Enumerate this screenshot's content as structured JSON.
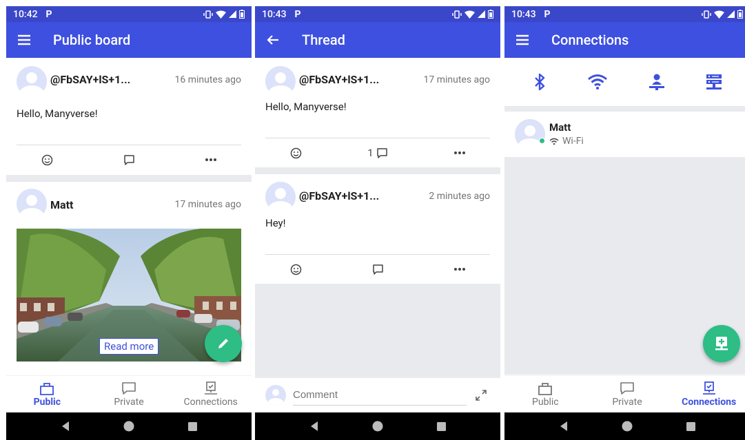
{
  "screens": [
    {
      "status_time": "10:42",
      "status_app_icon": "P",
      "title": "Public board",
      "posts": [
        {
          "author": "@FbSAY+lS+1...",
          "time": "16 minutes ago",
          "text": "Hello, Manyverse!"
        },
        {
          "author": "Matt",
          "time": "17 minutes ago",
          "read_more": "Read more"
        }
      ],
      "tabs": [
        {
          "label": "Public",
          "icon": "inbox-icon"
        },
        {
          "label": "Private",
          "icon": "chat-icon"
        },
        {
          "label": "Connections",
          "icon": "connections-icon"
        }
      ],
      "active_tab": "Public"
    },
    {
      "status_time": "10:43",
      "status_app_icon": "P",
      "title": "Thread",
      "posts": [
        {
          "author": "@FbSAY+lS+1...",
          "time": "17 minutes ago",
          "text": "Hello, Manyverse!",
          "reply_count": "1"
        },
        {
          "author": "@FbSAY+lS+1...",
          "time": "2 minutes ago",
          "text": "Hey!"
        }
      ],
      "comment_placeholder": "Comment"
    },
    {
      "status_time": "10:43",
      "status_app_icon": "P",
      "title": "Connections",
      "connection_icons": [
        "bluetooth-icon",
        "wifi-icon",
        "dht-icon",
        "server-icon"
      ],
      "peers": [
        {
          "name": "Matt",
          "network": "Wi-Fi"
        }
      ],
      "tabs": [
        {
          "label": "Public",
          "icon": "inbox-icon"
        },
        {
          "label": "Private",
          "icon": "chat-icon"
        },
        {
          "label": "Connections",
          "icon": "connections-icon"
        }
      ],
      "active_tab": "Connections"
    }
  ],
  "colors": {
    "status_bar": "#3b47c9",
    "app_bar": "#3e50e0",
    "fab": "#2dbd85",
    "accent": "#3e50e0",
    "background": "#e8eaed"
  }
}
